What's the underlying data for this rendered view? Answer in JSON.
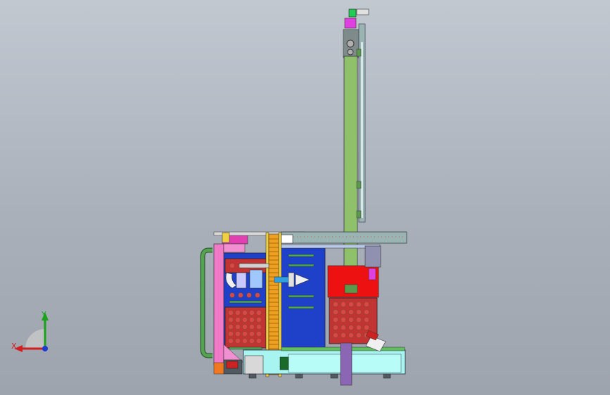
{
  "viewport": {
    "background_top": "#c2c8d0",
    "background_bottom": "#9da4ae"
  },
  "triad": {
    "x_label": "X",
    "y_label": "Y",
    "x_color": "#d11f1f",
    "y_color": "#1aa31a",
    "z_color": "#1f3ad1"
  },
  "colors": {
    "column": "#8fc06a",
    "rail": "#9ab4b4",
    "blue_panel": "#1f40c8",
    "red_panel": "#ee1111",
    "pink_plate": "#f07ac8",
    "yellow_plate": "#f0d040",
    "orange_screw": "#f0a020",
    "tray": "#c23434",
    "cyan_base": "#a8f4f0",
    "green_handle": "#56a452",
    "purple_post": "#8a66b4"
  }
}
